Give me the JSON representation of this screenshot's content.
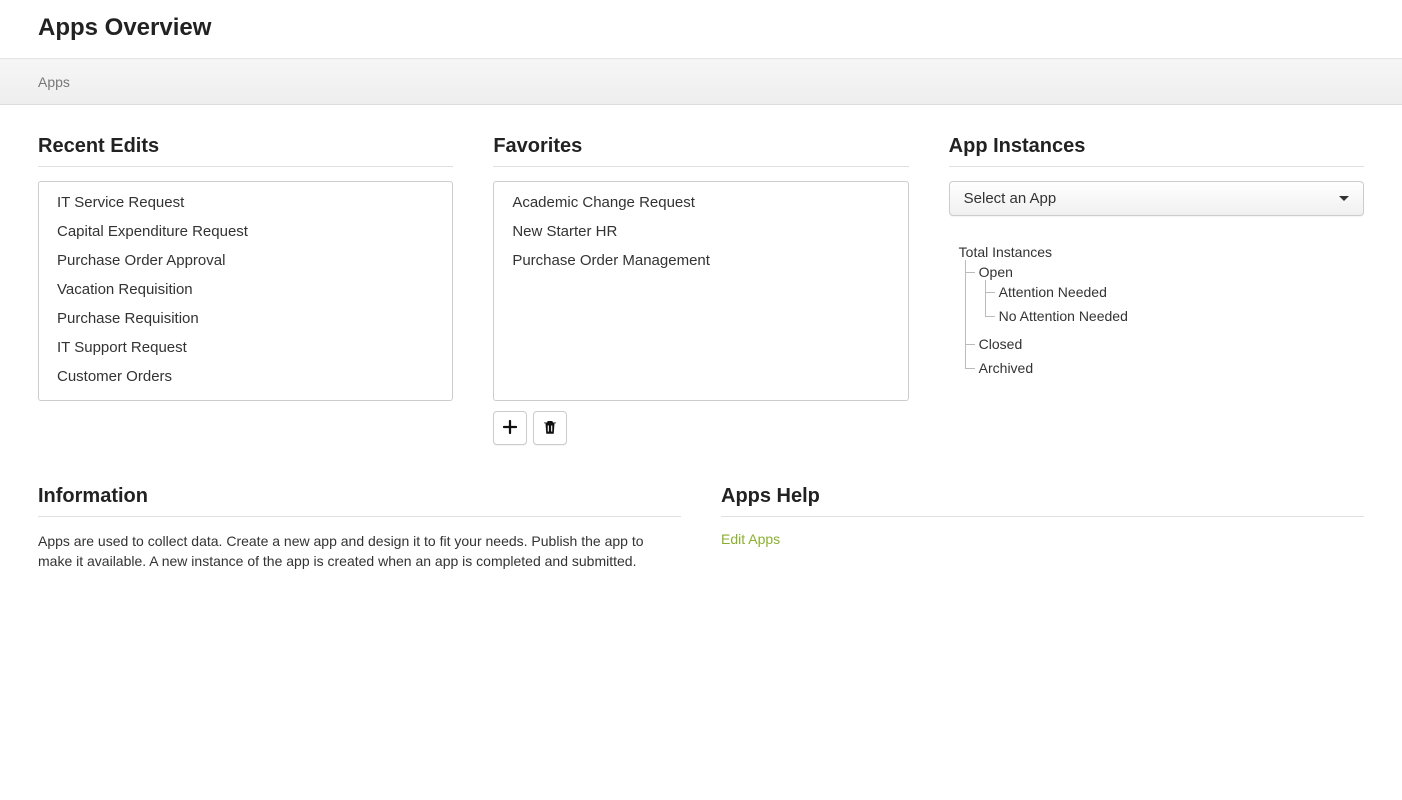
{
  "header": {
    "title": "Apps Overview"
  },
  "breadcrumb": {
    "label": "Apps"
  },
  "recentEdits": {
    "title": "Recent Edits",
    "items": [
      "IT Service Request",
      "Capital Expenditure Request",
      "Purchase Order Approval",
      "Vacation Requisition",
      "Purchase Requisition",
      "IT Support Request",
      "Customer Orders"
    ]
  },
  "favorites": {
    "title": "Favorites",
    "items": [
      "Academic Change Request",
      "New Starter HR",
      "Purchase Order Management"
    ]
  },
  "appInstances": {
    "title": "App Instances",
    "dropdownLabel": "Select an App",
    "tree": {
      "root": "Total Instances",
      "open": "Open",
      "attentionNeeded": "Attention Needed",
      "noAttentionNeeded": "No Attention Needed",
      "closed": "Closed",
      "archived": "Archived"
    }
  },
  "information": {
    "title": "Information",
    "body": "Apps are used to collect data. Create a new app and design it to fit your needs. Publish the app to make it available. A new instance of the app is created when an app is completed and submitted."
  },
  "appsHelp": {
    "title": "Apps Help",
    "linkLabel": "Edit Apps"
  }
}
